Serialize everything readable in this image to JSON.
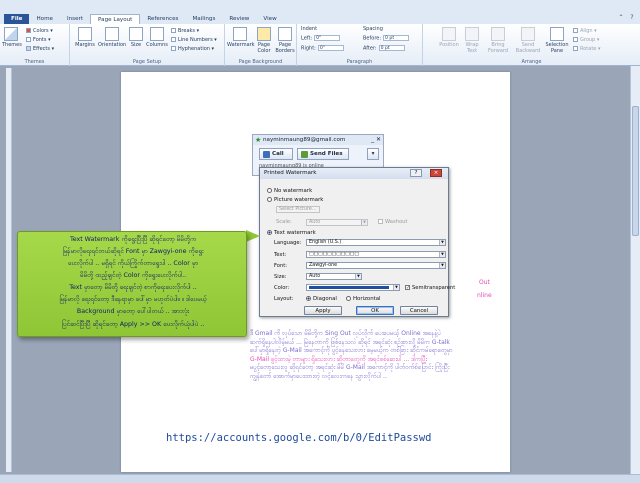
{
  "ribbon": {
    "tabs": [
      "File",
      "Home",
      "Insert",
      "Page Layout",
      "References",
      "Mailings",
      "Review",
      "View"
    ],
    "active_tab": "Page Layout",
    "themes": {
      "themes_label": "Themes",
      "colors_label": "Colors",
      "fonts_label": "Fonts",
      "effects_label": "Effects",
      "group_label": "Themes"
    },
    "page_setup": {
      "margins": "Margins",
      "orientation": "Orientation",
      "size": "Size",
      "columns": "Columns",
      "breaks": "Breaks",
      "line_numbers": "Line Numbers",
      "hyphenation": "Hyphenation",
      "group_label": "Page Setup"
    },
    "page_background": {
      "watermark": "Watermark",
      "page_color": "Page Color",
      "page_borders": "Page Borders",
      "group_label": "Page Background"
    },
    "paragraph": {
      "indent_label": "Indent",
      "left_label": "Left:",
      "left_value": "0\"",
      "right_label": "Right:",
      "right_value": "0\"",
      "spacing_label": "Spacing",
      "before_label": "Before:",
      "before_value": "0 pt",
      "after_label": "After:",
      "after_value": "0 pt",
      "group_label": "Paragraph"
    },
    "arrange": {
      "position": "Position",
      "wrap_text": "Wrap Text",
      "bring_forward": "Bring Forward",
      "send_backward": "Send Backward",
      "selection_pane": "Selection Pane",
      "align": "Align",
      "group": "Group",
      "rotate": "Rotate",
      "group_label": "Arrange"
    }
  },
  "gtalk": {
    "email": "nayminmaung89@gmail.com",
    "call_label": "Call",
    "send_files_label": "Send Files",
    "status": "nayminmaung89 is online"
  },
  "dialog": {
    "title": "Printed Watermark",
    "help": "?",
    "close": "×",
    "no_watermark": "No watermark",
    "picture_watermark": "Picture watermark",
    "select_picture": "Select Picture...",
    "scale_label": "Scale:",
    "scale_value": "Auto",
    "washout": "Washout",
    "text_watermark": "Text watermark",
    "language_label": "Language:",
    "language_value": "English (U.S.)",
    "text_label": "Text:",
    "text_value": "□□□□□□□□□□□",
    "font_label": "Font:",
    "font_value": "Zawgyi-one",
    "size_label": "Size:",
    "size_value": "Auto",
    "color_label": "Color:",
    "semitransparent": "Semitransparent",
    "layout_label": "Layout:",
    "diagonal": "Diagonal",
    "horizontal": "Horizontal",
    "apply": "Apply",
    "ok": "OK",
    "cancel": "Cancel"
  },
  "callout": {
    "lines": [
      "Text Watermark ကိုရွေးပြီးပြီ ဆိုရင်တော့ မိမိတို့က",
      "မြန်မာလိုရေးရင်တယ်ဆိုရင် Font မှာ Zawgyi-one ကိုရွေး",
      "ပေးလိုက်ပါ .. မရှိရင် ကိုယ်ကြိုက်တာရွေးပါ .. Color မှာ",
      "မိမိတို့ ထည့်ချင်တဲ့ Color ကိုရွေးပေးလိုက်ပါ..",
      "Text မှာတော့ မိမိတို့ ရေးချင်တဲ့ စာကိုရေးပေးလိုက်ပါ ..",
      "မြန်မာလို ရေးရင်တော့ ဒီနေရာမှာ ပေါ်မှာ မဟုတ်ပဲပါ။ ။ ဒါပေမယ့်",
      "Background မှာတော့ ပေါ်ပါတယ် .. အားလုံး",
      "ပြင်ဆင်ပြီးပြီ ဆိုရင်တော့ Apply >> OK ပေးလိုက်ယုံပါပဲ .."
    ]
  },
  "document": {
    "side_text_1": "Out",
    "side_text_2": "nline",
    "para_lines": [
      "ဒီ Gmail ကို လုပ်သော မိမိတို့က Sing Out လုပ်လိုက် ပေးပေမယ့် Online အနေနဲ့ပဲ",
      "ဆက်ရှိနေပါလိမ့်မယ် ... မြဲနေတာကို ဖြစ်နေသလဲ ဆိုရင် အရင်ဆုံး စဉ်းစားလို့ မိမိက G-talk",
      "ပေါ်မှာရှိနေတဲ့ G-Mail အကောင့်ကို ပွင့်နေသေးလား မေ့မယ့်က တစ်ခြား ဆိုင်ကမ်ခရာတွေမှာ",
      "G-Mail ဖွင့်ထားမဲ့ တာများ ရှိသေးလား ဆိုတာတွေကို အရင်စစ်ဆေးပါ ... ဒါကပြီး",
      "မပွင့်တော့သေးလူ ဆိုရင်တော့ အရင်ဆုံး မိမိ G-Mail အကောင့်ကို ပါတ်ဝက်စ်ပြောင်း ကြိုးပြီး",
      "ကျွန်တော် အောက်မှာပေးထားတဲ့ လင့်လေးကနေ သွားလိုက်ပါ .."
    ],
    "link": "https://accounts.google.com/b/0/EditPasswd"
  }
}
